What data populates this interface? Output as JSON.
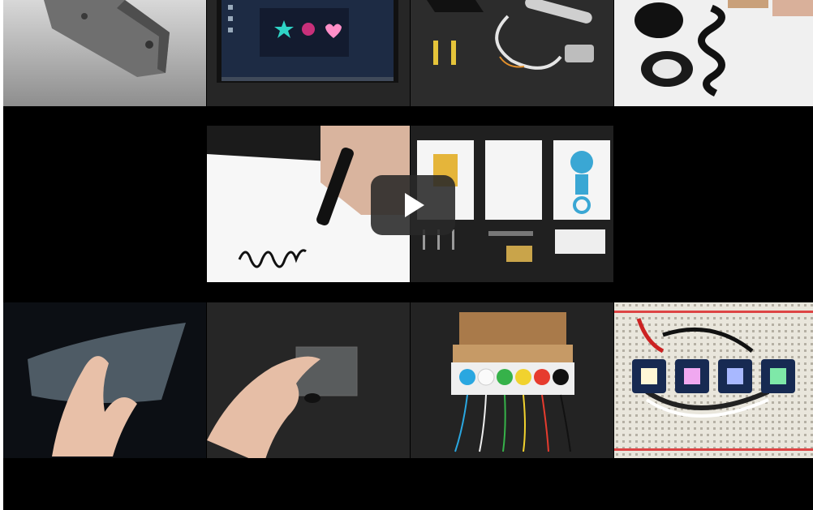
{
  "video": {
    "play_icon": "play-icon",
    "play_button_color": "#2a2a2a"
  },
  "tiles": [
    {
      "name": "angle-bracket",
      "icon": "metal-bracket"
    },
    {
      "name": "raspberry-pi-display",
      "icon": "monitor"
    },
    {
      "name": "sensor-and-switches",
      "icon": "cable"
    },
    {
      "name": "conductive-paint",
      "icon": "paint-jar"
    },
    {
      "name": "conductive-pen",
      "icon": "pen"
    },
    {
      "name": "robot-cards-kit",
      "icon": "robot-card"
    },
    {
      "name": "flexible-film",
      "icon": "plastic-sheet"
    },
    {
      "name": "glass-slide",
      "icon": "glass-slide"
    },
    {
      "name": "wire-spool-box",
      "icon": "wire-box"
    },
    {
      "name": "led-breadboard",
      "icon": "breadboard"
    }
  ]
}
